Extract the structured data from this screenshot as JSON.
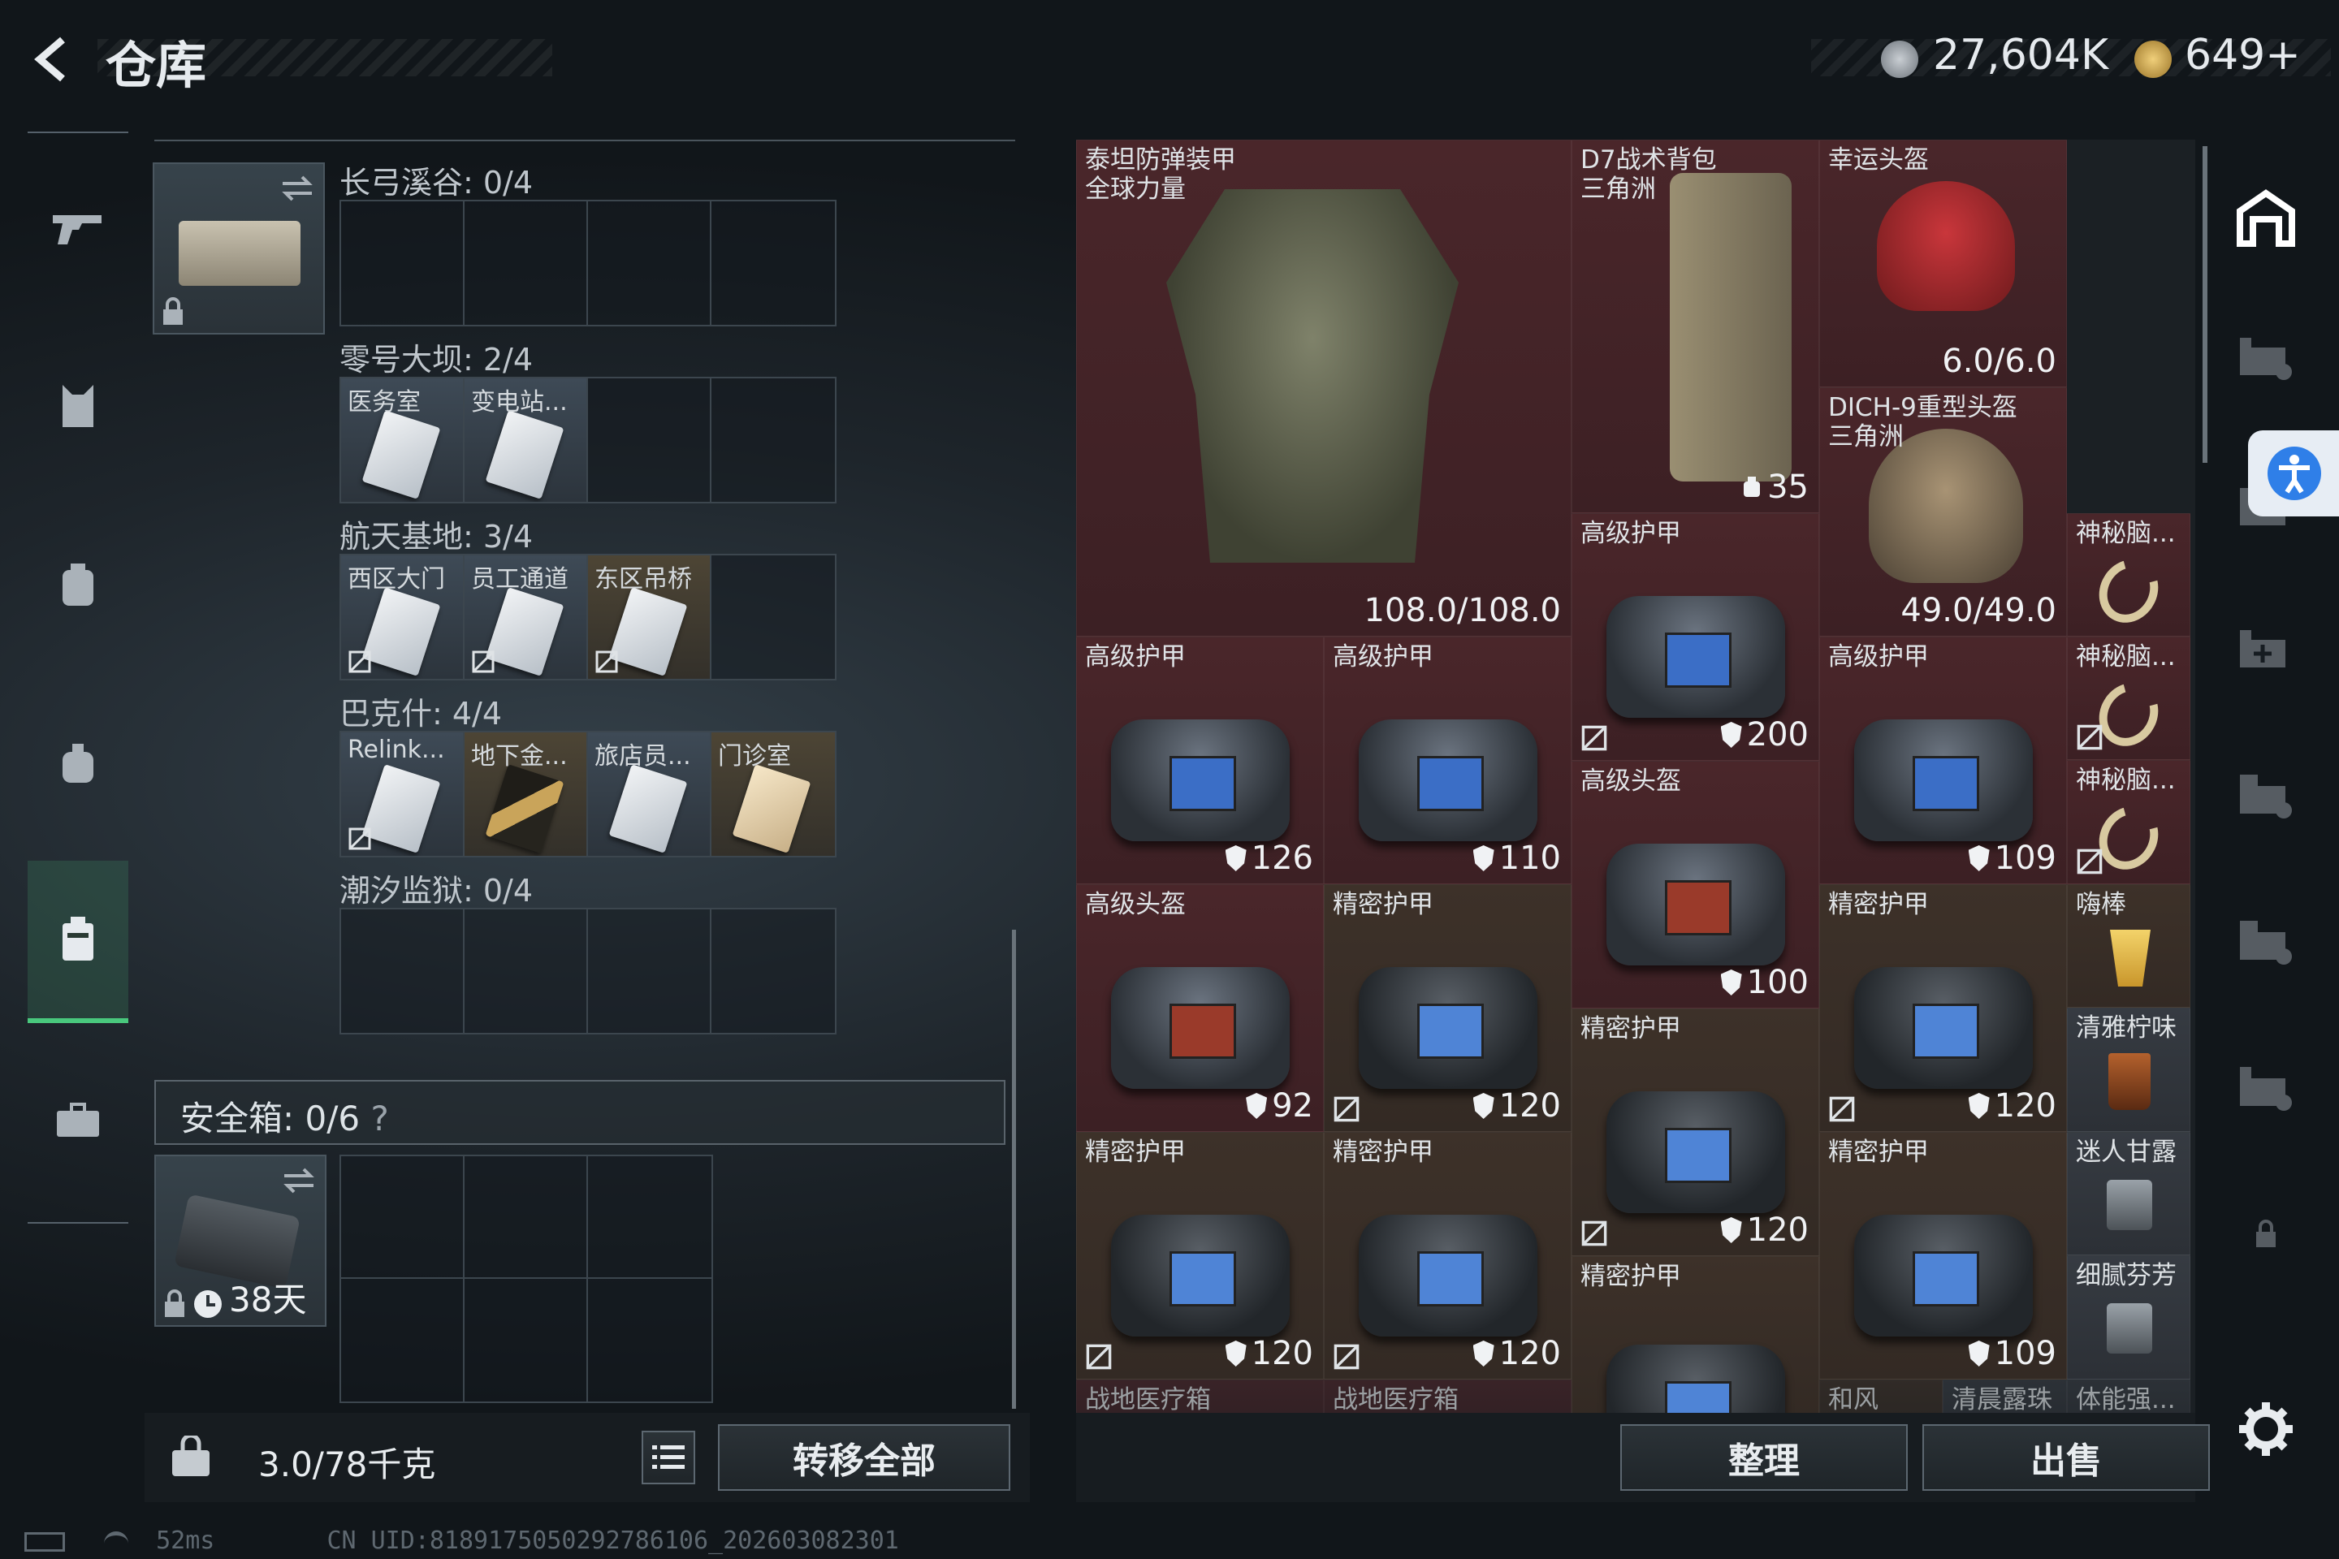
{
  "header": {
    "title": "仓库",
    "currency1": "27,604K",
    "currency2": "649+"
  },
  "left": {
    "regions": [
      {
        "label": "长弓溪谷: 0/4",
        "cells": []
      },
      {
        "label": "零号大坝: 2/4",
        "cells": [
          {
            "name": "医务室"
          },
          {
            "name": "变电站..."
          }
        ]
      },
      {
        "label": "航天基地: 3/4",
        "cells": [
          {
            "name": "西区大门"
          },
          {
            "name": "员工通道"
          },
          {
            "name": "东区吊桥"
          }
        ]
      },
      {
        "label": "巴克什: 4/4",
        "cells": [
          {
            "name": "Relink..."
          },
          {
            "name": "地下金..."
          },
          {
            "name": "旅店员..."
          },
          {
            "name": "门诊室"
          }
        ]
      },
      {
        "label": "潮汐监狱: 0/4",
        "cells": []
      }
    ],
    "safebox": {
      "label": "安全箱:  0/6",
      "help": "?",
      "timer": "38天"
    },
    "weight": "3.0/78千克",
    "transfer_all": "转移全部"
  },
  "right": {
    "items": [
      {
        "name": "泰坦防弹装甲\n全球力量",
        "value": "108.0/108.0"
      },
      {
        "name": "D7战术背包\n三角洲",
        "value": "35"
      },
      {
        "name": "幸运头盔",
        "value": "6.0/6.0"
      },
      {
        "name": "DICH-9重型头盔\n三角洲",
        "value": "49.0/49.0"
      },
      {
        "name": "高级护甲",
        "value": "200"
      },
      {
        "name": "神秘脑...",
        "value": ""
      },
      {
        "name": "高级护甲",
        "value": "126"
      },
      {
        "name": "高级护甲",
        "value": "110"
      },
      {
        "name": "高级护甲",
        "value": "109"
      },
      {
        "name": "神秘脑...",
        "value": ""
      },
      {
        "name": "神秘脑...",
        "value": ""
      },
      {
        "name": "高级头盔",
        "value": "100"
      },
      {
        "name": "高级头盔",
        "value": "92"
      },
      {
        "name": "精密护甲",
        "value": "120"
      },
      {
        "name": "精密护甲",
        "value": "120"
      },
      {
        "name": "嗨棒",
        "value": ""
      },
      {
        "name": "精密护甲",
        "value": "120"
      },
      {
        "name": "清雅柠味",
        "value": ""
      },
      {
        "name": "精密护甲",
        "value": "120"
      },
      {
        "name": "精密护甲",
        "value": "120"
      },
      {
        "name": "精密护甲",
        "value": "109"
      },
      {
        "name": "迷人甘露",
        "value": ""
      },
      {
        "name": "精密护甲",
        "value": ""
      },
      {
        "name": "细腻芬芳",
        "value": ""
      },
      {
        "name": "战地医疗箱",
        "value": ""
      },
      {
        "name": "战地医疗箱",
        "value": ""
      },
      {
        "name": "和风",
        "value": ""
      },
      {
        "name": "清晨露珠",
        "value": ""
      },
      {
        "name": "体能强...",
        "value": ""
      }
    ],
    "sort": "整理",
    "sell": "出售"
  },
  "status": {
    "ping": "52ms",
    "uid": "CN UID:8189175050292786106_202603082301"
  },
  "colors": {
    "accent": "#49c87d",
    "red_bg": "#4a262a",
    "brown_bg": "#3d3129"
  },
  "icons": [
    "back-arrow-icon",
    "gun-icon",
    "armor-icon",
    "backpack-icon",
    "bag-icon",
    "case-icon",
    "briefcase-icon",
    "gear-icon",
    "lock-icon",
    "swap-icon",
    "clock-icon",
    "list-icon",
    "shield-icon",
    "no-trade-icon"
  ]
}
